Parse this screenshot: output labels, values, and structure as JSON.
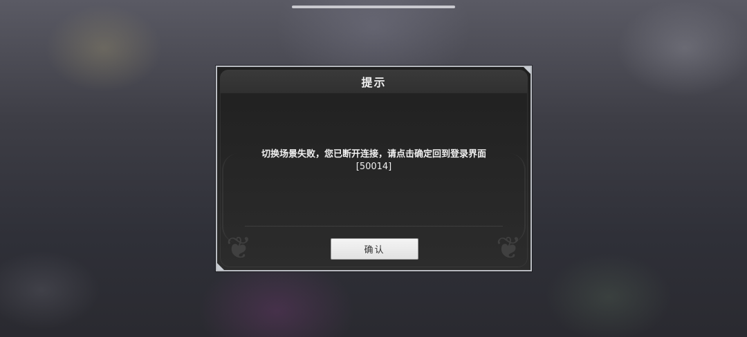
{
  "dialog": {
    "title": "提示",
    "message": "切换场景失败，您已断开连接，请点击确定回到登录界面",
    "error_code": "[50014]",
    "confirm_label": "确认"
  },
  "colors": {
    "dialog_bg": "#262626",
    "dialog_border": "#b9bcc2",
    "button_bg": "#eeeeee",
    "text": "#f0f0f0"
  }
}
